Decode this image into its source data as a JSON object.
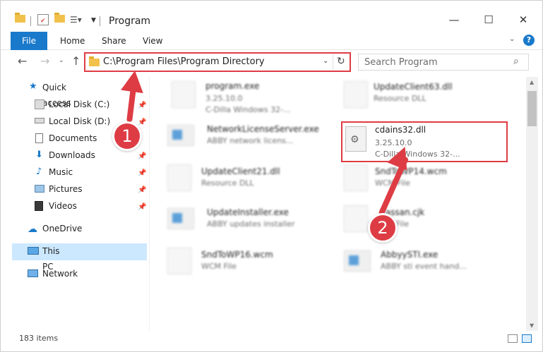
{
  "window": {
    "title": "Program",
    "controls": [
      "—",
      "☐",
      "✕"
    ]
  },
  "ribbon": {
    "tabs": [
      "File",
      "Home",
      "Share",
      "View"
    ],
    "help_label": "?"
  },
  "address_bar": {
    "path": "C:\\Program Files\\Program Directory",
    "search_placeholder": "Search Program"
  },
  "sidebar": {
    "items": [
      {
        "label": "Quick access"
      },
      {
        "label": "Local Disk (C:)"
      },
      {
        "label": "Local Disk (D:)"
      },
      {
        "label": "Documents"
      },
      {
        "label": "Downloads"
      },
      {
        "label": "Music"
      },
      {
        "label": "Pictures"
      },
      {
        "label": "Videos"
      },
      {
        "label": "OneDrive"
      },
      {
        "label": "This PC"
      },
      {
        "label": "Network"
      }
    ]
  },
  "files": {
    "left": [
      {
        "name": "program.exe",
        "line2": "3.25.10.0",
        "line3": "C-Dilla Windows 32-..."
      },
      {
        "name": "NetworkLicenseServer.exe",
        "line2": "ABBY network licens..."
      },
      {
        "name": "UpdateClient21.dll",
        "line2": "Resource DLL"
      },
      {
        "name": "UpdateInstaller.exe",
        "line2": "ABBY updates installer"
      },
      {
        "name": "SndToWP16.wcm",
        "line2": "WCM File"
      }
    ],
    "right": [
      {
        "name": "UpdateClient63.dll",
        "line2": "Resource DLL"
      },
      {
        "name": "cdains32.dll",
        "line2": "3.25.10.0",
        "line3": "C-Dilla Windows 32-..."
      },
      {
        "name": "SndToWP14.wcm",
        "line2": "WCM File"
      },
      {
        "name": "kassan.cjk",
        "line2": "CJK File"
      },
      {
        "name": "AbbyySTI.exe",
        "line2": "ABBY sti event hand..."
      }
    ]
  },
  "status": {
    "item_count": "183 items"
  },
  "callouts": {
    "one": "1",
    "two": "2"
  },
  "colors": {
    "accent_blue": "#1979ca",
    "callout_red": "#de3c44",
    "selection": "#cce8ff"
  }
}
